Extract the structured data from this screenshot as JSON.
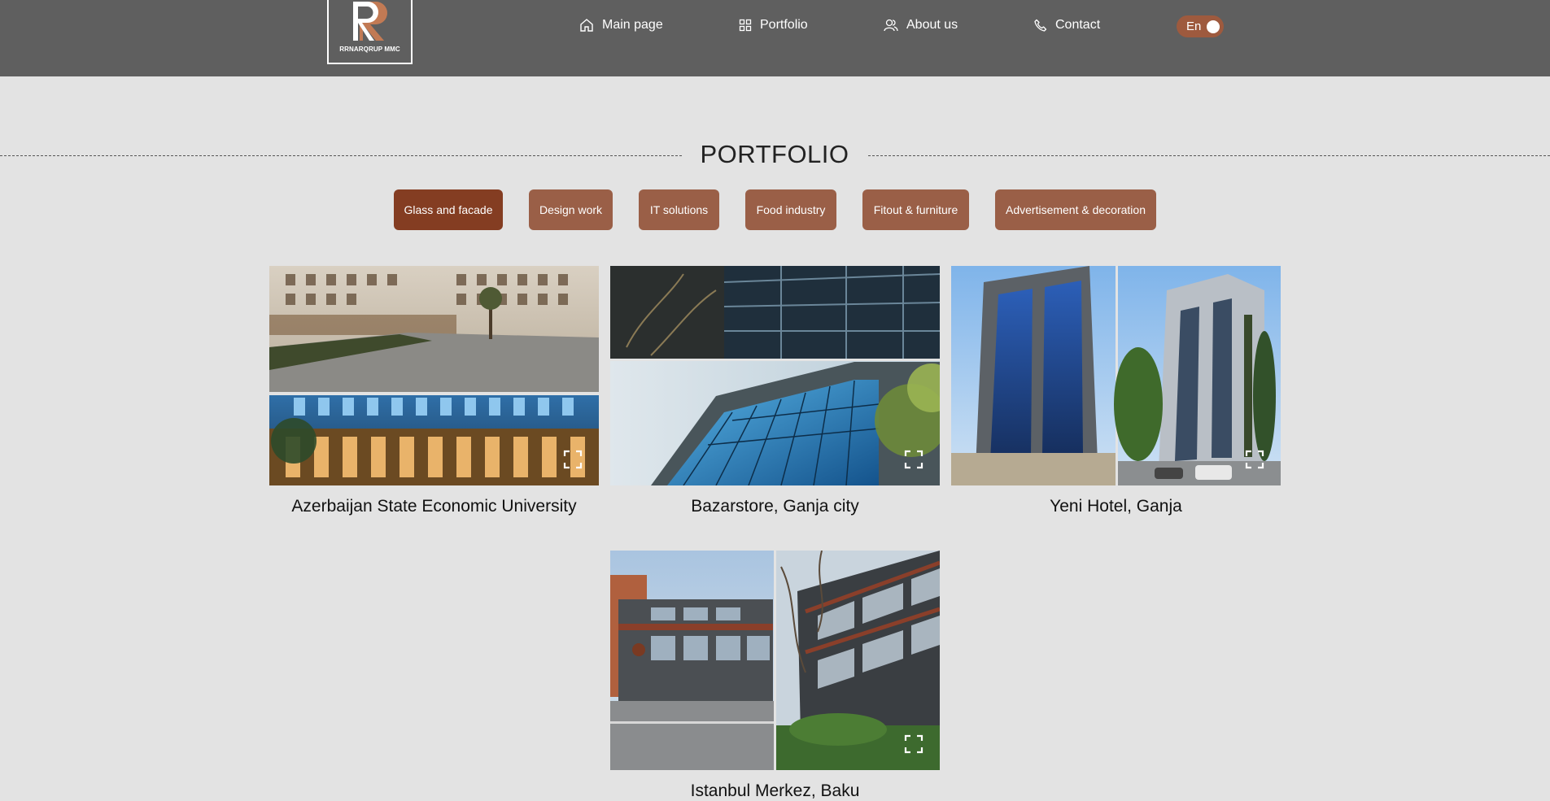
{
  "header": {
    "logo_text": "RRNARQRUP MMC",
    "nav": [
      {
        "label": "Main page",
        "icon": "home-icon"
      },
      {
        "label": "Portfolio",
        "icon": "grid-icon"
      },
      {
        "label": "About us",
        "icon": "users-icon"
      },
      {
        "label": "Contact",
        "icon": "phone-icon"
      }
    ],
    "language": "En"
  },
  "section": {
    "title": "PORTFOLIO"
  },
  "filters": [
    {
      "label": "Glass and facade",
      "active": true
    },
    {
      "label": "Design work",
      "active": false
    },
    {
      "label": "IT solutions",
      "active": false
    },
    {
      "label": "Food industry",
      "active": false
    },
    {
      "label": "Fitout & furniture",
      "active": false
    },
    {
      "label": "Advertisement & decoration",
      "active": false
    }
  ],
  "projects": [
    {
      "title": "Azerbaijan State Economic University"
    },
    {
      "title": "Bazarstore, Ganja city"
    },
    {
      "title": "Yeni Hotel, Ganja"
    },
    {
      "title": "Istanbul Merkez, Baku"
    }
  ],
  "colors": {
    "header_bg": "#5f5f5f",
    "page_bg": "#e3e3e3",
    "filter_active": "#843d22",
    "filter_default": "#9a5f47",
    "toggle_bg": "#9e5a3e"
  }
}
